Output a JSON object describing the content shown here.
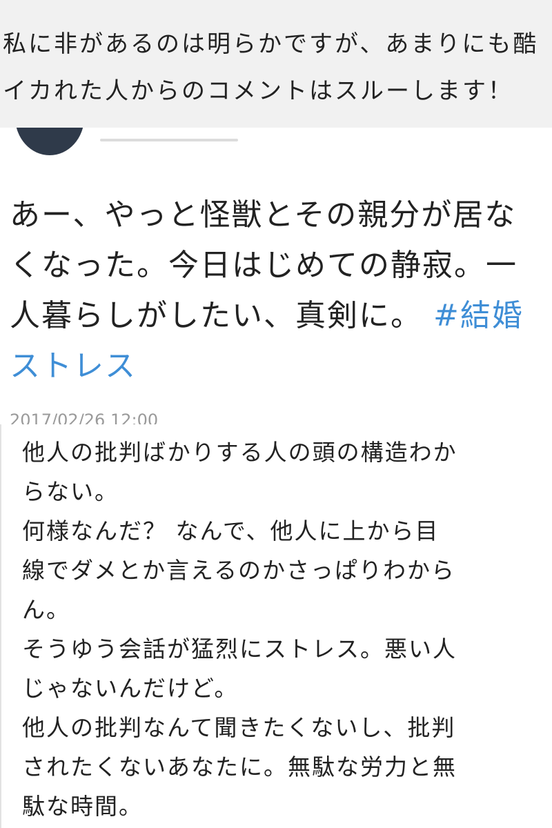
{
  "banner": {
    "line1": "私に非があるのは明らかですが、あまりにも酷",
    "line2": "イカれた人からのコメントはスルーします！"
  },
  "post": {
    "text": "あー、やっと怪獣とその親分が居なくなった。今日はじめての静寂。一人暮らしがしたい、真剣に。",
    "hashtag": "#結婚ストレス",
    "timestamp": "2017/02/26 12:00"
  },
  "reply": {
    "lines": [
      "他人の批判ばかりする人の頭の構造わか",
      "らない。",
      "何様なんだ？ なんで、他人に上から目",
      "線でダメとか言えるのかさっぱりわから",
      "ん。",
      "そうゆう会話が猛烈にストレス。悪い人",
      "じゃないんだけど。",
      "他人の批判なんて聞きたくないし、批判",
      "されたくないあなたに。無駄な労力と無",
      "駄な時間。"
    ]
  }
}
